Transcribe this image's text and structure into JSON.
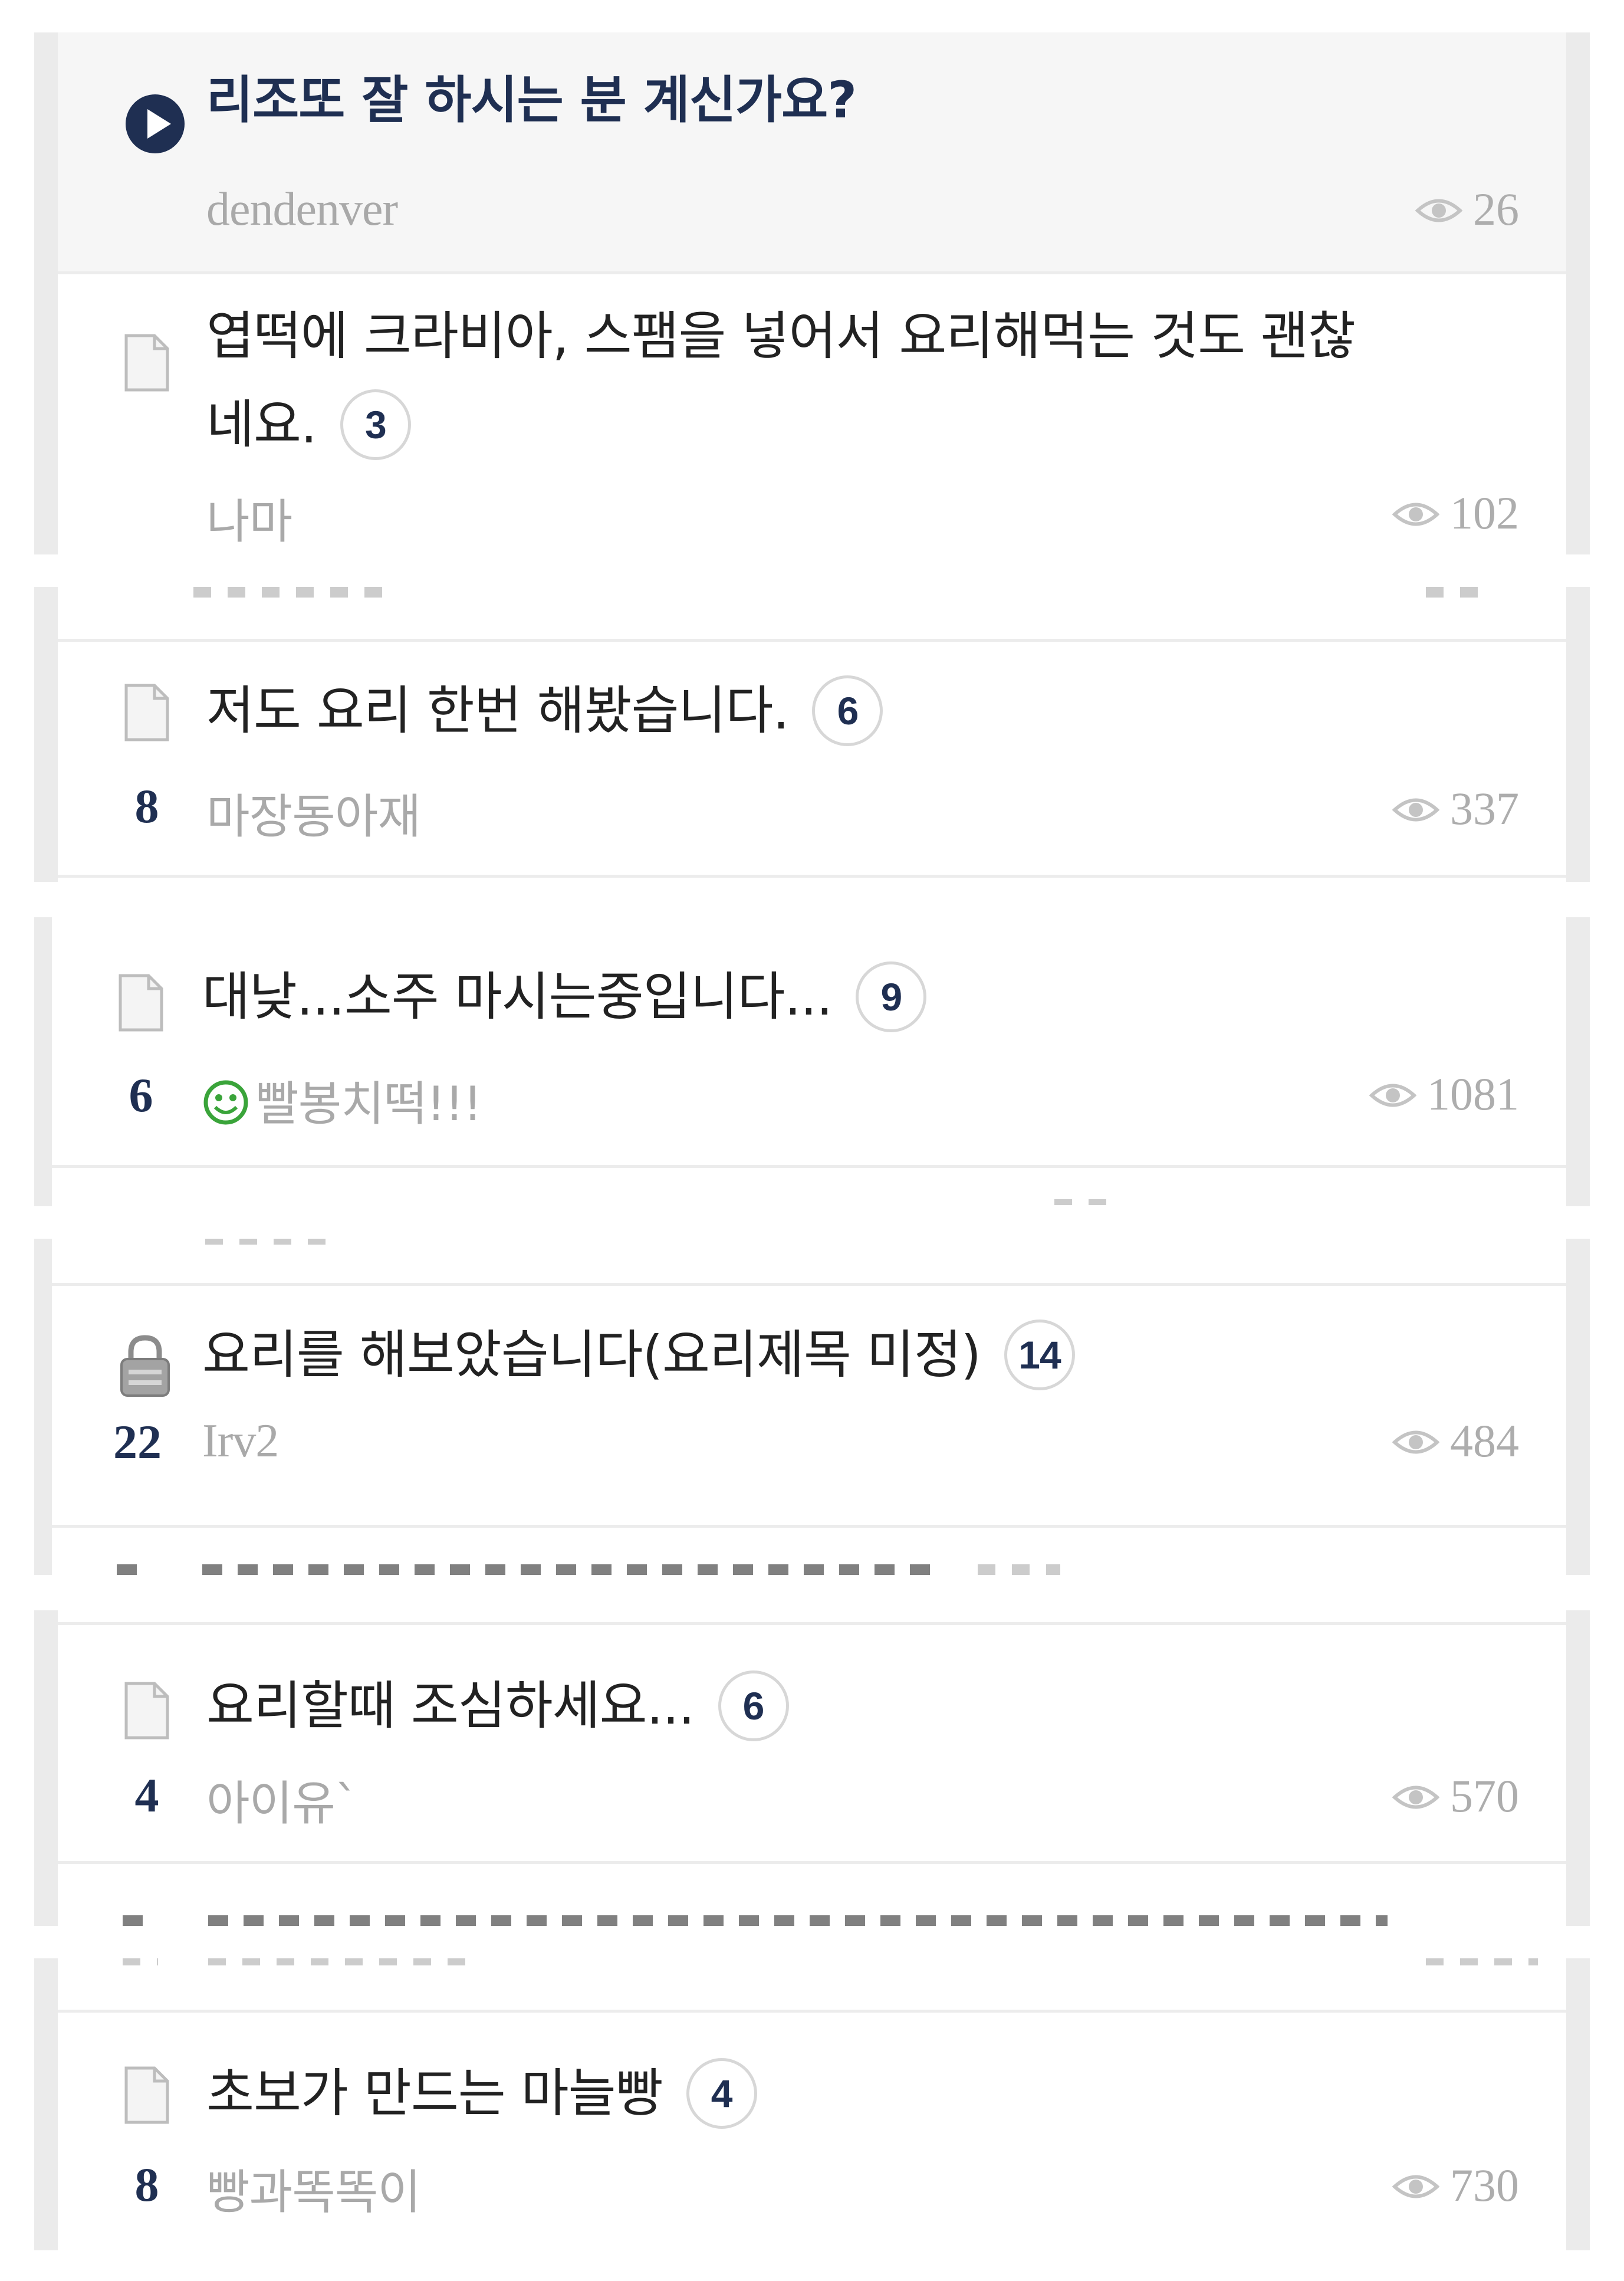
{
  "posts": [
    {
      "title": "리조또 잘 하시는 분 계신가요?",
      "author": "dendenver",
      "views": "26",
      "icon": "play-icon",
      "notice": true
    },
    {
      "title_line1": "엽떡에 크라비아, 스팸을 넣어서 요리해먹는 것도 괜찮",
      "title_line2": "네요.",
      "comments": "3",
      "author": "나마",
      "views": "102",
      "icon": "doc-icon"
    },
    {
      "title": "저도 요리 한번 해봤습니다.",
      "comments": "6",
      "recommend": "8",
      "author": "마장동아재",
      "views": "337",
      "icon": "doc-icon"
    },
    {
      "title": "대낮...소주 마시는중입니다...",
      "comments": "9",
      "recommend": "6",
      "author": "빨봉치떡!!!",
      "views": "1081",
      "icon": "doc-icon",
      "author_icon": "smile-icon"
    },
    {
      "title": "요리를 해보았습니다(요리제목 미정)",
      "comments": "14",
      "recommend": "22",
      "author": "Irv2",
      "views": "484",
      "icon": "lock-icon"
    },
    {
      "title": "요리할때 조심하세요...",
      "comments": "6",
      "recommend": "4",
      "author": "아이유`",
      "views": "570",
      "icon": "doc-icon"
    },
    {
      "title": "초보가 만드는 마늘빵",
      "comments": "4",
      "recommend": "8",
      "author": "빵과똑똑이",
      "views": "730",
      "icon": "doc-icon"
    }
  ],
  "colors": {
    "accent": "#1f2f52",
    "muted": "#a9a9a9",
    "divider": "#ececec",
    "frame": "#ebebeb",
    "smile": "#3aa43a"
  }
}
